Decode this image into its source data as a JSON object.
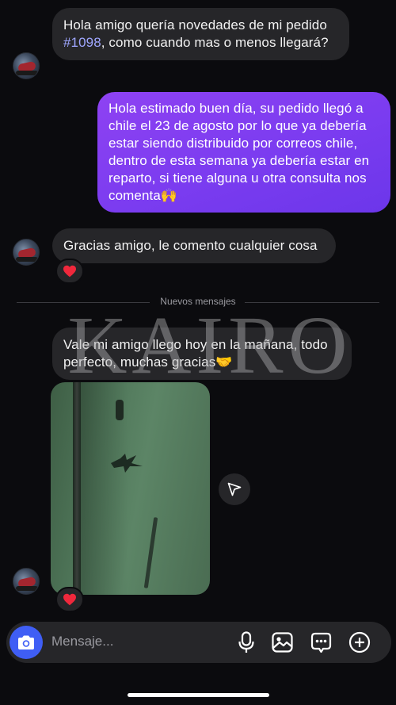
{
  "messages": [
    {
      "id": "m1",
      "parts": [
        "Hola amigo quería novedades de mi pedido ",
        "#1098",
        ", como cuando mas o menos llegará?"
      ]
    },
    {
      "id": "m2",
      "text": "Hola estimado buen día, su pedido llegó a chile el 23 de agosto por lo que ya debería estar siendo distribuido por correos chile, dentro de esta semana ya debería estar en reparto, si tiene alguna u otra consulta nos comenta🙌"
    },
    {
      "id": "m3",
      "text": "Gracias amigo, le comento cualquier cosa",
      "reaction": "❤️"
    },
    {
      "id": "m4",
      "text": "Vale mi amigo llego hoy en la mañana, todo perfecto, muchas gracias🤝"
    },
    {
      "id": "m5",
      "type": "photo",
      "reaction": "❤️"
    }
  ],
  "divider": {
    "label": "Nuevos mensajes"
  },
  "watermark": "KAIRO",
  "composer": {
    "placeholder": "Mensaje..."
  },
  "colors": {
    "outgoing_bubble": "#7b3cf0",
    "incoming_bubble": "#262629",
    "camera_button": "#3f5ef5",
    "link": "#9fa6ff",
    "background": "#0b0b0e"
  },
  "icons": {
    "camera": "camera-icon",
    "mic": "microphone-icon",
    "gallery": "image-icon",
    "sticker": "chat-bubble-icon",
    "plus": "plus-icon",
    "share": "paper-plane-icon",
    "heart": "heart-icon"
  }
}
